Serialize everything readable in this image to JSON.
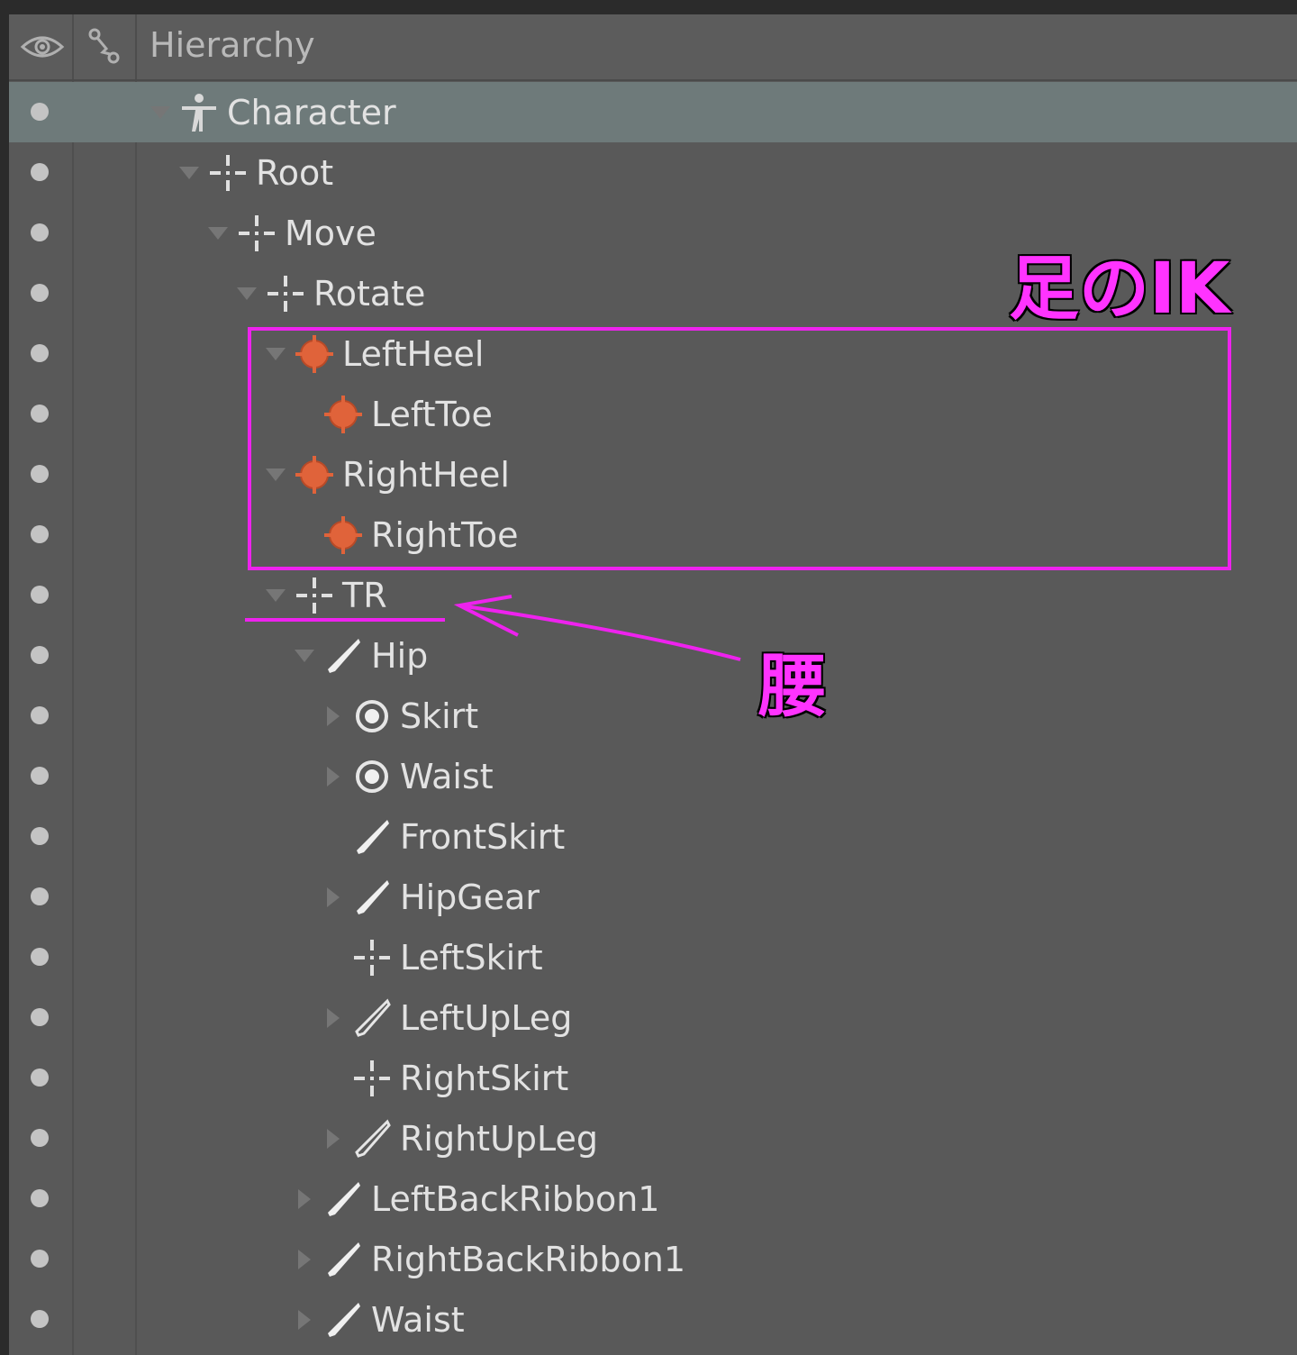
{
  "header": {
    "title": "Hierarchy",
    "visibility_icon": "eye-icon",
    "link_icon": "link-icon"
  },
  "colors": {
    "panel_bg": "#595959",
    "selected_row": "#6e7a7a",
    "annotation": "#ee22ee",
    "ik_icon": "#e0633a"
  },
  "rows": [
    {
      "label": "Character",
      "icon": "character-icon",
      "arrow": "down",
      "depth": 0
    },
    {
      "label": "Root",
      "icon": "transform-icon",
      "arrow": "down",
      "depth": 1
    },
    {
      "label": "Move",
      "icon": "transform-icon",
      "arrow": "down",
      "depth": 2
    },
    {
      "label": "Rotate",
      "icon": "transform-icon",
      "arrow": "down",
      "depth": 3
    },
    {
      "label": "LeftHeel",
      "icon": "ik-target-icon",
      "arrow": "down",
      "depth": 4
    },
    {
      "label": "LeftToe",
      "icon": "ik-target-icon",
      "arrow": "none",
      "depth": 5
    },
    {
      "label": "RightHeel",
      "icon": "ik-target-icon",
      "arrow": "down",
      "depth": 4
    },
    {
      "label": "RightToe",
      "icon": "ik-target-icon",
      "arrow": "none",
      "depth": 5
    },
    {
      "label": "TR",
      "icon": "transform-icon",
      "arrow": "down",
      "depth": 4
    },
    {
      "label": "Hip",
      "icon": "bone-icon",
      "arrow": "down",
      "depth": 5
    },
    {
      "label": "Skirt",
      "icon": "radio-icon",
      "arrow": "right",
      "depth": 6
    },
    {
      "label": "Waist",
      "icon": "radio-icon",
      "arrow": "right",
      "depth": 6
    },
    {
      "label": "FrontSkirt",
      "icon": "bone-icon",
      "arrow": "none",
      "depth": 6
    },
    {
      "label": "HipGear",
      "icon": "bone-icon",
      "arrow": "right",
      "depth": 6
    },
    {
      "label": "LeftSkirt",
      "icon": "transform-icon",
      "arrow": "none",
      "depth": 6
    },
    {
      "label": "LeftUpLeg",
      "icon": "bone-outline-icon",
      "arrow": "right",
      "depth": 6
    },
    {
      "label": "RightSkirt",
      "icon": "transform-icon",
      "arrow": "none",
      "depth": 6
    },
    {
      "label": "RightUpLeg",
      "icon": "bone-outline-icon",
      "arrow": "right",
      "depth": 6
    },
    {
      "label": "LeftBackRibbon1",
      "icon": "bone-icon",
      "arrow": "right",
      "depth": 5
    },
    {
      "label": "RightBackRibbon1",
      "icon": "bone-icon",
      "arrow": "right",
      "depth": 5
    },
    {
      "label": "Waist",
      "icon": "bone-icon",
      "arrow": "right",
      "depth": 5
    }
  ],
  "annotations": {
    "ik_label": "足のIK",
    "hip_label": "腰"
  }
}
